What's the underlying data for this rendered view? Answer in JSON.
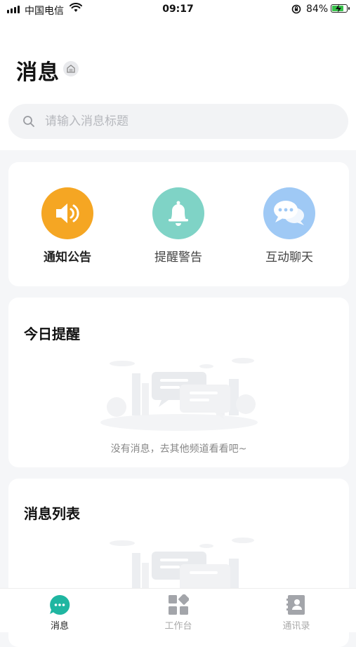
{
  "status_bar": {
    "carrier": "中国电信",
    "time": "09:17",
    "battery": "84%",
    "battery_level": 0.84
  },
  "header": {
    "title": "消息",
    "title_icon": "home-icon"
  },
  "search": {
    "placeholder": "请输入消息标题",
    "icon": "search-icon"
  },
  "categories": [
    {
      "label": "通知公告",
      "icon": "speaker-icon",
      "color": "#f5a623",
      "selected": true
    },
    {
      "label": "提醒警告",
      "icon": "bell-icon",
      "color": "#7fd3c6",
      "selected": false
    },
    {
      "label": "互动聊天",
      "icon": "chat-icon",
      "color": "#9fc9f5",
      "selected": false
    }
  ],
  "today_reminders": {
    "title": "今日提醒",
    "empty_text": "没有消息，去其他频道看看吧~"
  },
  "message_list": {
    "title": "消息列表"
  },
  "tabbar": {
    "items": [
      {
        "label": "消息",
        "icon": "chat-bubble-icon",
        "active": true,
        "color": "#1fb6a1"
      },
      {
        "label": "工作台",
        "icon": "grid-icon",
        "active": false
      },
      {
        "label": "通讯录",
        "icon": "contacts-icon",
        "active": false
      }
    ]
  }
}
